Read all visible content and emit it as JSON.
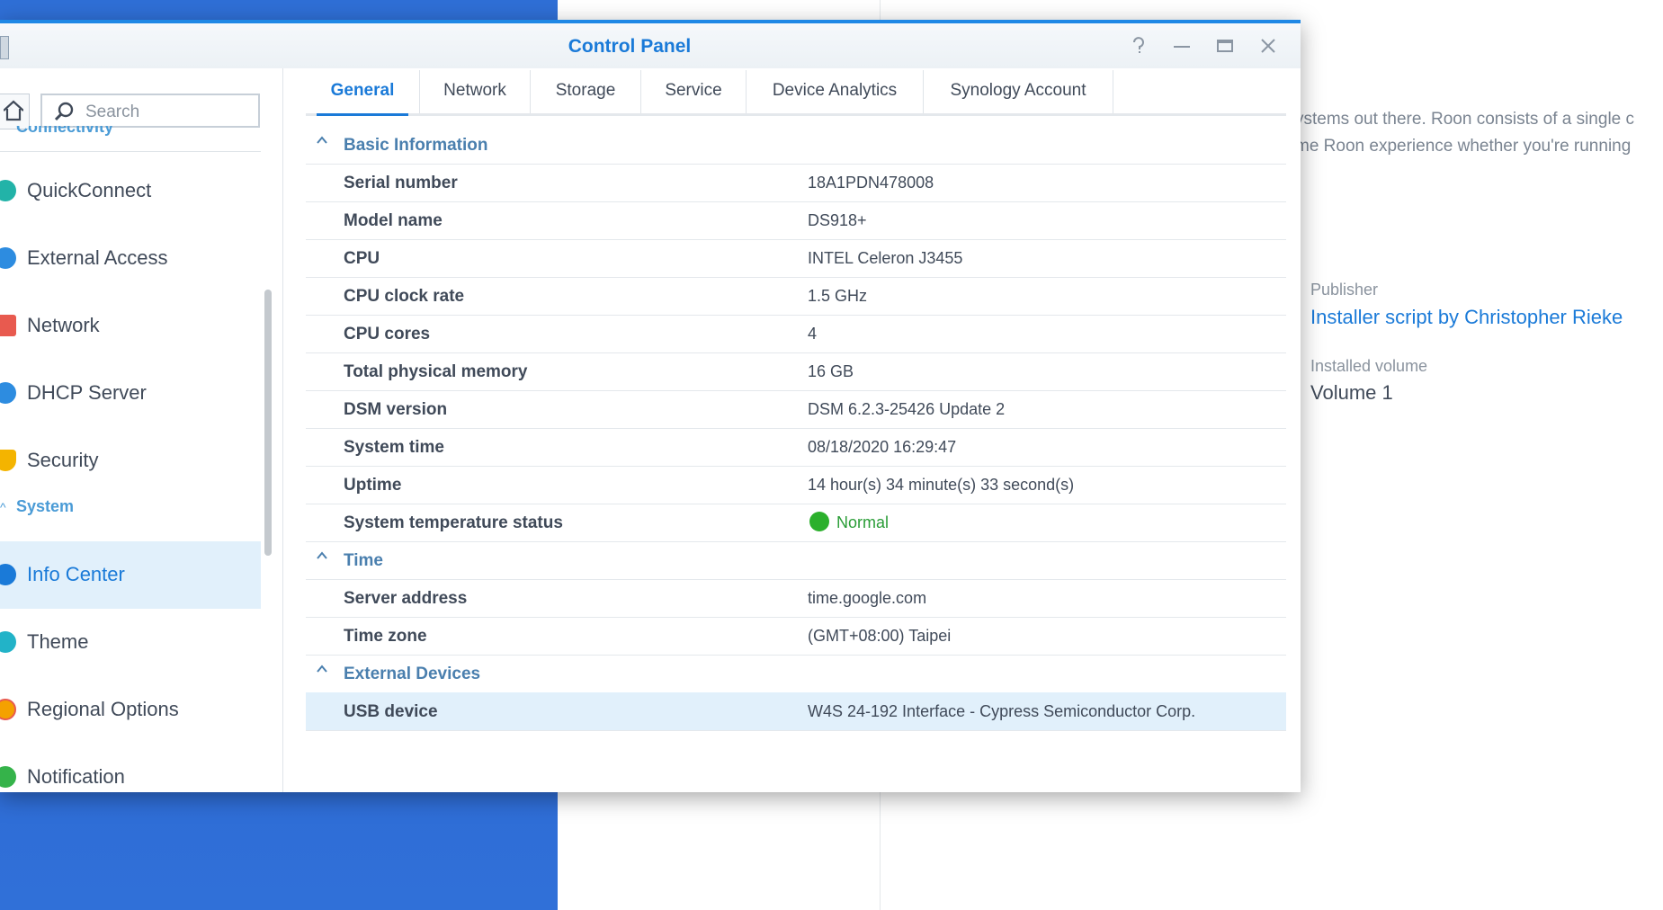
{
  "background": {
    "description_lines": [
      "ystems out there. Roon consists of a single c",
      "me Roon experience whether you're running"
    ],
    "publisher_label": "Publisher",
    "publisher_value": "Installer script by Christopher Rieke",
    "volume_label": "Installed volume",
    "volume_value": "Volume 1"
  },
  "window": {
    "title": "Control Panel",
    "buttons": {
      "help": "?",
      "minimize": "—",
      "maximize": "▭",
      "close": "✕"
    }
  },
  "sidebar": {
    "search_placeholder": "Search",
    "category_clipped": "Connectivity",
    "items_connectivity": [
      {
        "label": "QuickConnect",
        "icon": "quickconnect-icon",
        "color": "#22b3a8"
      },
      {
        "label": "External Access",
        "icon": "external-access-icon",
        "color": "#2d8ce0"
      },
      {
        "label": "Network",
        "icon": "network-icon",
        "color": "#e85a4f"
      },
      {
        "label": "DHCP Server",
        "icon": "dhcp-server-icon",
        "color": "#2d8ce0"
      },
      {
        "label": "Security",
        "icon": "security-icon",
        "color": "#f4b400"
      }
    ],
    "category_system": "System",
    "items_system": [
      {
        "label": "Info Center",
        "icon": "info-center-icon",
        "color": "#1a7ad8"
      },
      {
        "label": "Theme",
        "icon": "theme-icon",
        "color": "#22b3c8"
      },
      {
        "label": "Regional Options",
        "icon": "regional-options-icon",
        "color": "#f4a100"
      },
      {
        "label": "Notification",
        "icon": "notification-icon",
        "color": "#35b34a"
      }
    ],
    "active_item": "Info Center"
  },
  "tabs": [
    "General",
    "Network",
    "Storage",
    "Service",
    "Device Analytics",
    "Synology Account"
  ],
  "active_tab": "General",
  "sections": {
    "basic": {
      "title": "Basic Information",
      "rows": [
        {
          "key": "Serial number",
          "value": "18A1PDN478008"
        },
        {
          "key": "Model name",
          "value": "DS918+"
        },
        {
          "key": "CPU",
          "value": "INTEL Celeron J3455"
        },
        {
          "key": "CPU clock rate",
          "value": "1.5 GHz"
        },
        {
          "key": "CPU cores",
          "value": "4"
        },
        {
          "key": "Total physical memory",
          "value": "16 GB"
        },
        {
          "key": "DSM version",
          "value": "DSM 6.2.3-25426 Update 2"
        },
        {
          "key": "System time",
          "value": "08/18/2020 16:29:47"
        },
        {
          "key": "Uptime",
          "value": "14 hour(s) 34 minute(s) 33 second(s)"
        },
        {
          "key": "System temperature status",
          "value": "Normal"
        }
      ]
    },
    "time": {
      "title": "Time",
      "rows": [
        {
          "key": "Server address",
          "value": "time.google.com"
        },
        {
          "key": "Time zone",
          "value": "(GMT+08:00) Taipei"
        }
      ]
    },
    "external": {
      "title": "External Devices",
      "rows": [
        {
          "key": "USB device",
          "value": "W4S 24-192 Interface - Cypress Semiconductor Corp."
        }
      ]
    }
  },
  "colors": {
    "accent": "#1a7ad8",
    "status_ok": "#2bb02c",
    "desktop": "#2c67d2"
  }
}
